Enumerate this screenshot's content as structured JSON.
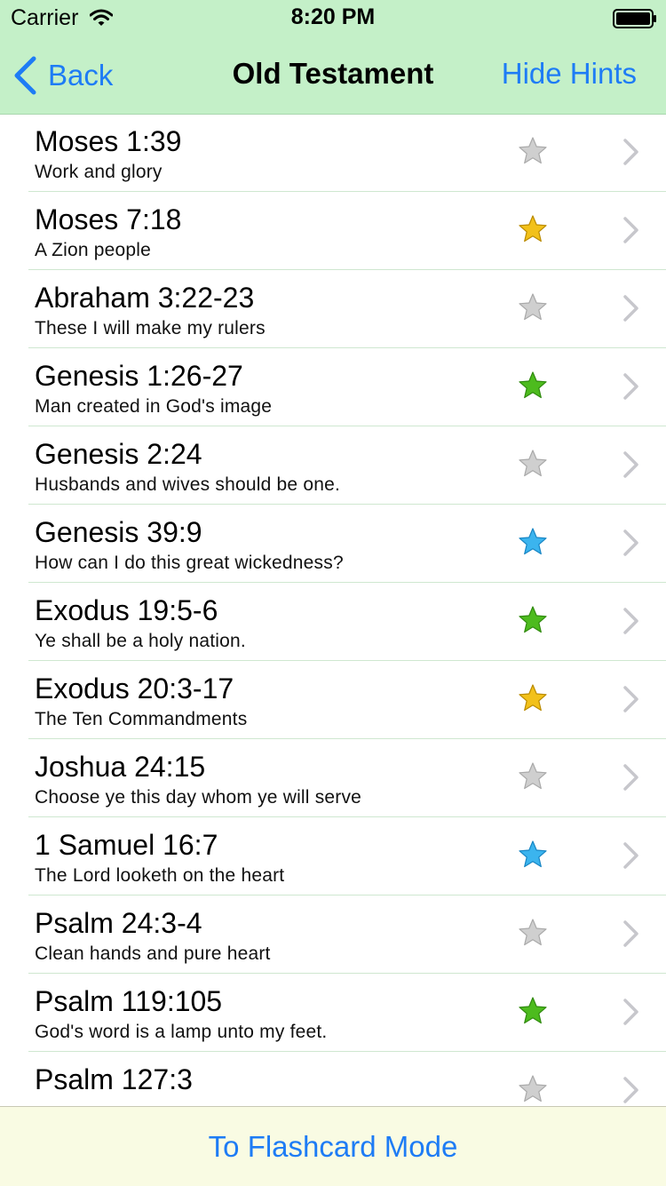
{
  "status": {
    "carrier": "Carrier",
    "time": "8:20 PM"
  },
  "nav": {
    "back_label": "Back",
    "title": "Old Testament",
    "right_label": "Hide Hints"
  },
  "colors": {
    "star_gray": "#cfcfcf",
    "star_gold": "#f2c11a",
    "star_green": "#4dbb1e",
    "star_blue": "#3bb4ee",
    "accent": "#1e7cf5",
    "header_bg": "#c4f0c8"
  },
  "rows": [
    {
      "ref": "Moses 1:39",
      "hint": "Work and glory",
      "star": "gray"
    },
    {
      "ref": "Moses 7:18",
      "hint": "A Zion people",
      "star": "gold"
    },
    {
      "ref": "Abraham 3:22-23",
      "hint": "These I will make my rulers",
      "star": "gray"
    },
    {
      "ref": "Genesis 1:26-27",
      "hint": "Man created in God's image",
      "star": "green"
    },
    {
      "ref": "Genesis 2:24",
      "hint": "Husbands and wives should be one.",
      "star": "gray"
    },
    {
      "ref": "Genesis 39:9",
      "hint": "How can I do this great wickedness?",
      "star": "blue"
    },
    {
      "ref": "Exodus 19:5-6",
      "hint": "Ye shall be a holy nation.",
      "star": "green"
    },
    {
      "ref": "Exodus 20:3-17",
      "hint": "The Ten Commandments",
      "star": "gold"
    },
    {
      "ref": "Joshua 24:15",
      "hint": "Choose ye this day whom ye will serve",
      "star": "gray"
    },
    {
      "ref": "1 Samuel 16:7",
      "hint": "The Lord looketh on the heart",
      "star": "blue"
    },
    {
      "ref": "Psalm 24:3-4",
      "hint": "Clean hands and pure heart",
      "star": "gray"
    },
    {
      "ref": "Psalm 119:105",
      "hint": "God's word is a lamp unto my feet.",
      "star": "green"
    },
    {
      "ref": "Psalm 127:3",
      "hint": "",
      "star": "gray"
    }
  ],
  "footer": {
    "button_label": "To Flashcard Mode"
  }
}
